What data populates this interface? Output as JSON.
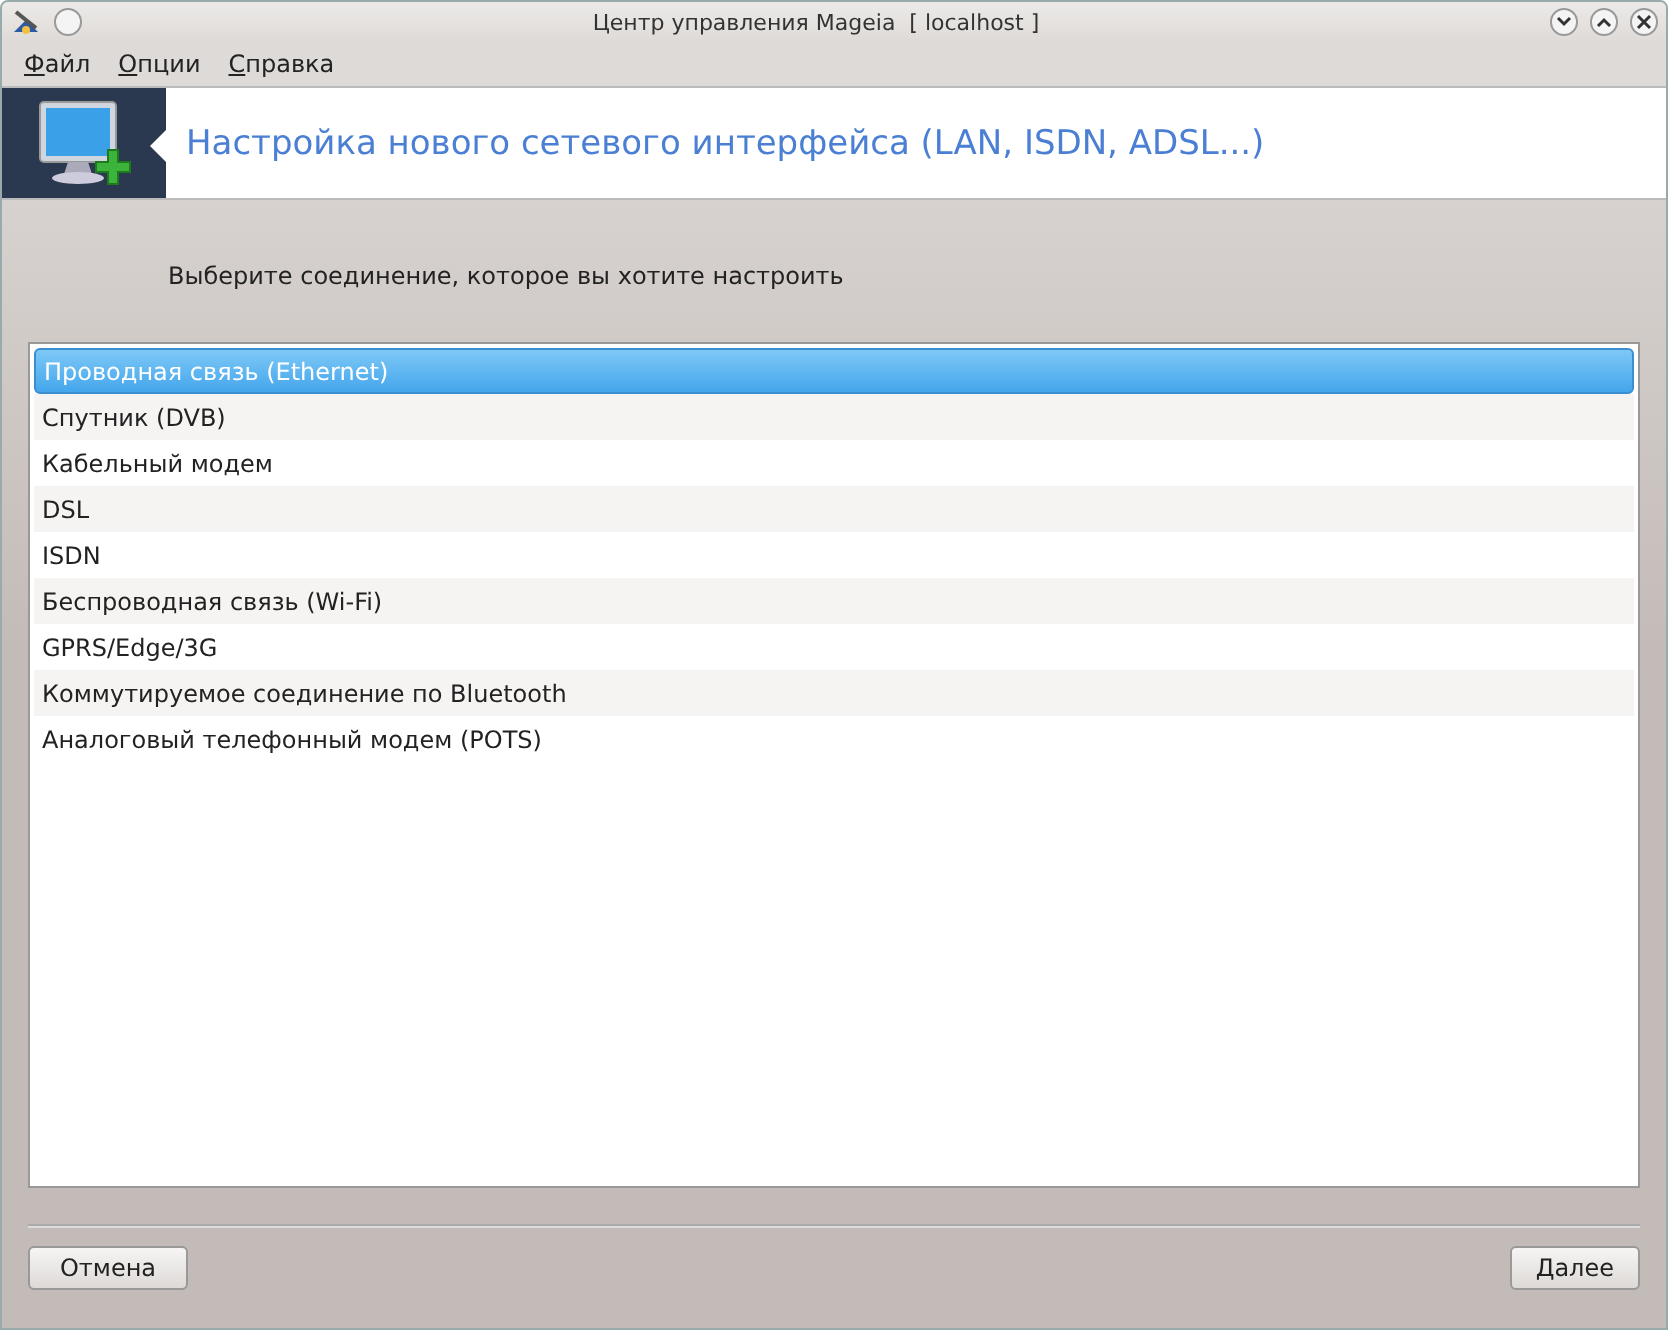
{
  "window": {
    "title": "Центр управления Mageia  [ localhost ]"
  },
  "menu": [
    "Файл",
    "Опции",
    "Справка"
  ],
  "header": {
    "title": "Настройка нового сетевого интерфейса (LAN, ISDN, ADSL...)"
  },
  "prompt": "Выберите соединение, которое вы хотите настроить",
  "connections": [
    {
      "label": "Проводная связь (Ethernet)",
      "selected": true
    },
    {
      "label": "Спутник (DVB)",
      "selected": false
    },
    {
      "label": "Кабельный модем",
      "selected": false
    },
    {
      "label": "DSL",
      "selected": false
    },
    {
      "label": "ISDN",
      "selected": false
    },
    {
      "label": "Беспроводная связь (Wi-Fi)",
      "selected": false
    },
    {
      "label": "GPRS/Edge/3G",
      "selected": false
    },
    {
      "label": "Коммутируемое соединение по Bluetooth",
      "selected": false
    },
    {
      "label": "Аналоговый телефонный модем (POTS)",
      "selected": false
    }
  ],
  "buttons": {
    "cancel": "Отмена",
    "next": "Далее"
  }
}
